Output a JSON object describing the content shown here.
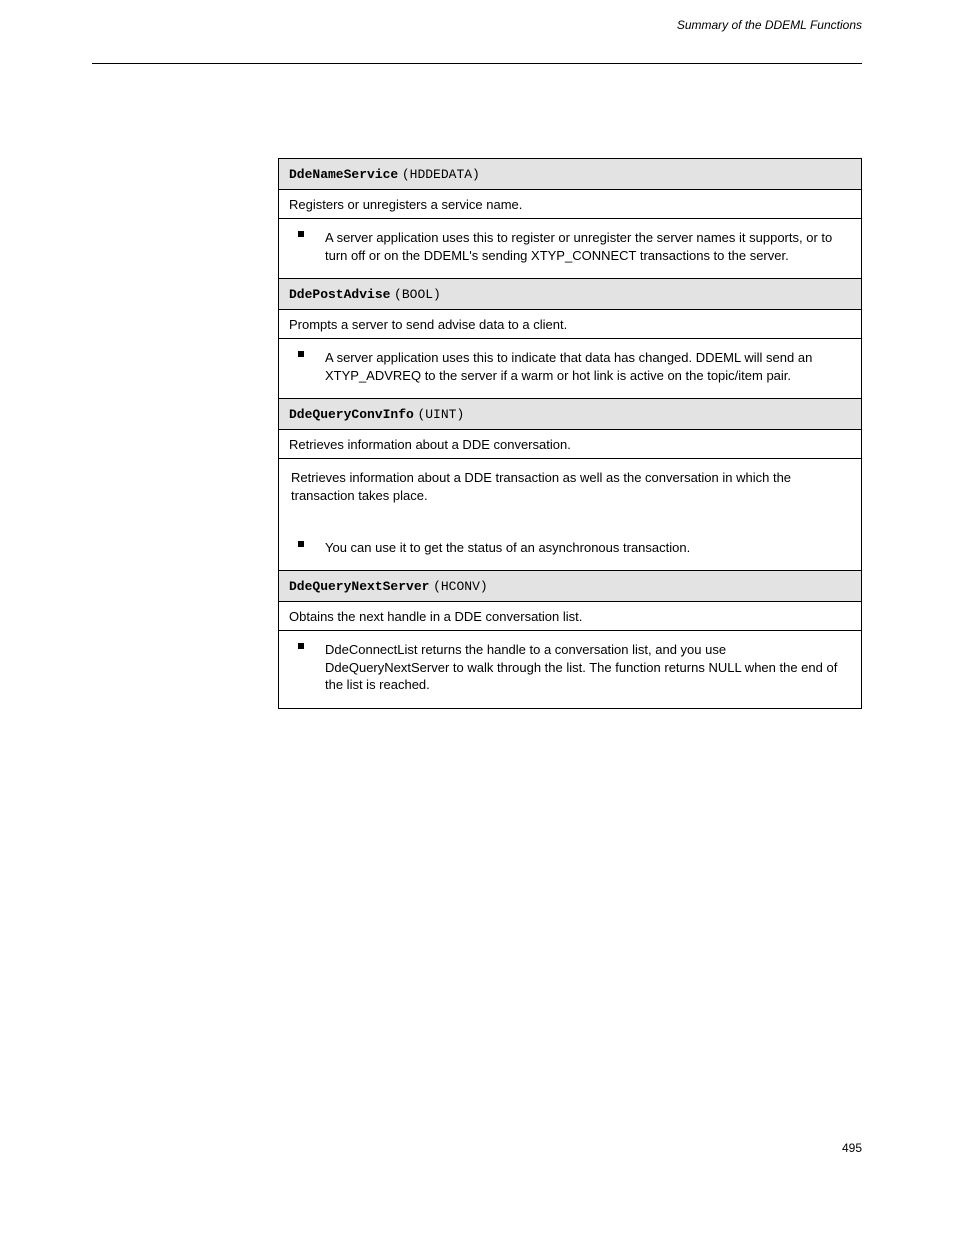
{
  "header": {
    "running_head": "Summary of the DDEML Functions",
    "page_number": "495"
  },
  "sections": [
    {
      "code": {
        "label": "DdeNameService",
        "ret": "(HDDEDATA)"
      },
      "summary": "Registers or unregisters a service name.",
      "detail": {
        "bullets": [
          "A server application uses this to register or unregister the server names it supports, or to turn off or on the DDEML's sending XTYP_CONNECT transactions to the server."
        ]
      }
    },
    {
      "code": {
        "label": "DdePostAdvise",
        "ret": "(BOOL)"
      },
      "summary": "Prompts a server to send advise data to a client.",
      "detail": {
        "bullets": [
          "A server application uses this to indicate that data has changed. DDEML will send an XTYP_ADVREQ to the server if a warm or hot link is active on the topic/item pair."
        ]
      }
    },
    {
      "code": {
        "label": "DdeQueryConvInfo",
        "ret": "(UINT)"
      },
      "summary": "Retrieves information about a DDE conversation.",
      "detail": {
        "lead": "Retrieves information about a DDE transaction as well as the conversation in which the transaction takes place.",
        "bullets": [
          "You can use it to get the status of an asynchronous transaction."
        ]
      }
    },
    {
      "code": {
        "label": "DdeQueryNextServer",
        "ret": "(HCONV)"
      },
      "summary": "Obtains the next handle in a DDE conversation list.",
      "detail": {
        "bullets": [
          "DdeConnectList returns the handle to a conversation list, and you use DdeQueryNextServer to walk through the list. The function returns NULL when the end of the list is reached."
        ]
      }
    }
  ]
}
